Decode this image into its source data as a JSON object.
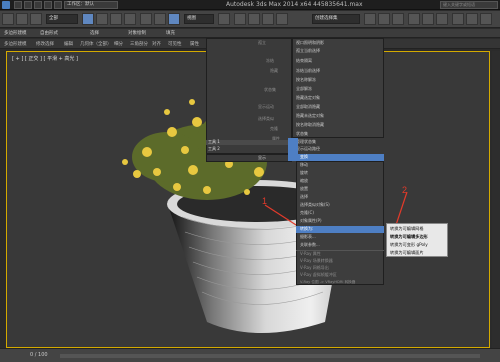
{
  "titlebar": {
    "workspace": "工作区：默认",
    "title": "Autodesk 3ds Max  2014 x64    445835641.max",
    "search": "键入关键字或短语"
  },
  "toolbar": {
    "selection_filter": "全部",
    "view_combo": "视图",
    "named_selection": "创建选择集"
  },
  "menubar": {
    "items": [
      "多边形建模",
      "自由形式",
      "选择",
      "对象绘制",
      "填充"
    ]
  },
  "ribbon": {
    "items": [
      "多边形建模",
      "修改选择",
      "编辑",
      "几何体（全部）",
      "细分",
      "三角剖分",
      "对齐",
      "可见性",
      "属性"
    ]
  },
  "viewport": {
    "label": "[ + ] [ 正交 ] [ 平滑 + 高光 ]"
  },
  "quad_left": {
    "items": [
      "视口照明和阴影",
      "孤立当前选择",
      "结束隔离",
      "冻结当前选择",
      "按名称解冻",
      "全部解冻",
      "隐藏选定对象",
      "全部取消隐藏",
      "隐藏未选定对象",
      "按名称取消隐藏",
      "状态集",
      "管理状态集",
      "显示运动路径"
    ]
  },
  "quad_right_labels": [
    "工具 1",
    "工具 2",
    "显示",
    "变换"
  ],
  "quad_labels": [
    "移动",
    "旋转",
    "缩放",
    "放置",
    "选择",
    "选择类似对象(S)",
    "克隆(C)",
    "对象属性(P)",
    "曲线编辑器...",
    "摄影表...",
    "关联参数...",
    "转换为:"
  ],
  "quad_bottom": {
    "items": [
      "V-Ray 属性",
      "V-Ray 场景转换器",
      "V-Ray 网格导出",
      "V-Ray 虚拟帧缓冲区",
      "V-Ray 位图 -> VRayHDRI 转换器",
      "V-Ray 场景文件导出器",
      "V-Ray 动画场景导出器"
    ]
  },
  "left_labels": [
    "孤立",
    "冻结",
    "隐藏",
    "状态集",
    "显示运动",
    "选择类似",
    "克隆",
    "属性",
    "曲线",
    "关联"
  ],
  "submenu": {
    "items": [
      "转换为可编辑网格",
      "转换为可编辑多边形",
      "转换为可变形 gPoly",
      "转换为可编辑面片"
    ]
  },
  "callouts": {
    "one": "1",
    "two": "2"
  },
  "statusbar": {
    "frame": "0 / 100"
  },
  "colors": {
    "highlight": "#4e7fc4",
    "viewport_border": "#d4aa00",
    "callout": "#e23a2a"
  }
}
